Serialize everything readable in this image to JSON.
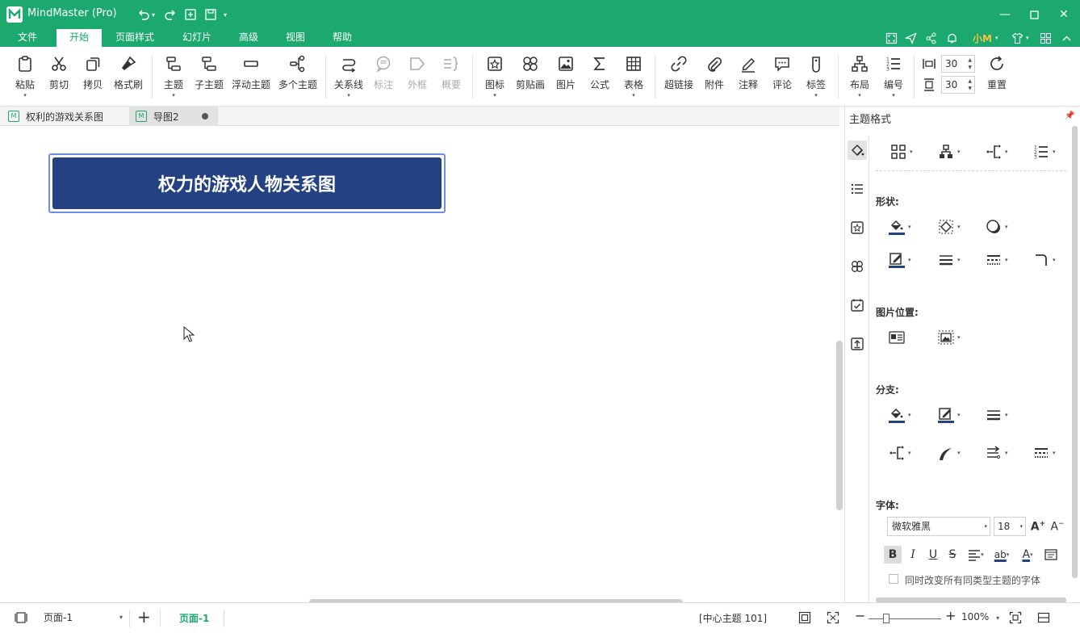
{
  "app": {
    "title": "MindMaster (Pro)"
  },
  "menu": [
    {
      "label": "文件"
    },
    {
      "label": "开始"
    },
    {
      "label": "页面样式"
    },
    {
      "label": "幻灯片"
    },
    {
      "label": "高级"
    },
    {
      "label": "视图"
    },
    {
      "label": "帮助"
    }
  ],
  "active_menu": "开始",
  "user": {
    "name": "小M"
  },
  "ribbon": {
    "paste": "粘贴",
    "cut": "剪切",
    "copy": "拷贝",
    "format_painter": "格式刷",
    "topic": "主题",
    "subtopic": "子主题",
    "floating_topic": "浮动主题",
    "multiple_topics": "多个主题",
    "relationship": "关系线",
    "callout": "标注",
    "boundary": "外框",
    "summary": "概要",
    "icon": "图标",
    "clipart": "剪贴画",
    "picture": "图片",
    "formula": "公式",
    "table": "表格",
    "hyperlink": "超链接",
    "attachment": "附件",
    "note": "注释",
    "comment": "评论",
    "tag": "标签",
    "layout": "布局",
    "numbering": "编号",
    "spacing_h": "30",
    "spacing_v": "30",
    "reset": "重置"
  },
  "tabs": [
    {
      "label": "权利的游戏关系图",
      "icon": "mindmap-file-icon"
    },
    {
      "label": "导图2",
      "icon": "mindmap-file-icon"
    }
  ],
  "canvas": {
    "central_topic": "权力的游戏人物关系图"
  },
  "panel": {
    "title": "主题格式",
    "shape_section": "形状:",
    "image_position_section": "图片位置:",
    "branch_section": "分支:",
    "font_section": "字体:",
    "font_family": "微软雅黑",
    "font_size": "18",
    "bold": "B",
    "italic": "I",
    "underline": "U",
    "strike": "S",
    "highlight": "ab",
    "font_color": "A",
    "apply_all_label": "同时改变所有同类型主题的字体"
  },
  "status": {
    "page_selector": "页面-1",
    "add_page": "+",
    "active_page": "页面-1",
    "selection_info": "[中心主题 101]",
    "zoom": "100%",
    "zoom_minus": "−",
    "zoom_plus": "+"
  },
  "colors": {
    "brand": "#1ba96f",
    "topic_fill": "#244282",
    "topic_selection": "#6b8fe8",
    "user_accent": "#f5c242"
  }
}
